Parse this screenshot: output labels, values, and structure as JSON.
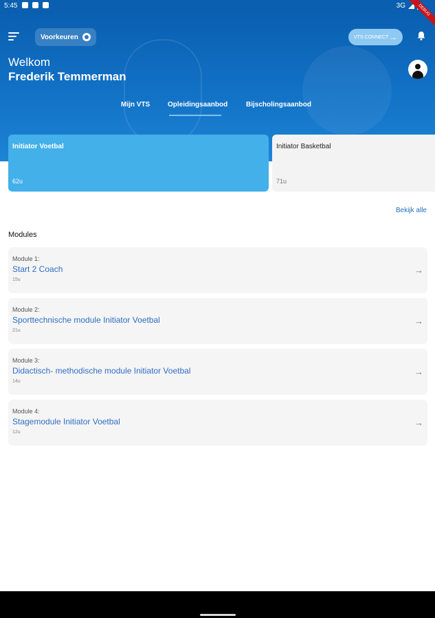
{
  "status_bar": {
    "time": "5:45",
    "network": "3G",
    "icons": [
      "notification-icon",
      "screenshot-icon",
      "download-icon"
    ]
  },
  "header": {
    "preferences_label": "Voorkeuren",
    "connect_label": "VTS CONNECT",
    "welcome": "Welkom",
    "user_name": "Frederik Temmerman"
  },
  "tabs": [
    {
      "label": "Mijn VTS",
      "active": false
    },
    {
      "label": "Opleidingsaanbod",
      "active": true
    },
    {
      "label": "Bijscholingsaanbod",
      "active": false
    }
  ],
  "courses": [
    {
      "title": "Initiator Voetbal",
      "hours": "62u",
      "selected": true
    },
    {
      "title": "Initiator Basketbal",
      "hours": "71u",
      "selected": false
    }
  ],
  "view_all_label": "Bekijk alle",
  "section_title": "Modules",
  "modules": [
    {
      "number": "Module 1:",
      "name": "Start 2 Coach",
      "hours": "15u"
    },
    {
      "number": "Module 2:",
      "name": "Sporttechnische module Initiator Voetbal",
      "hours": "21u"
    },
    {
      "number": "Module 3:",
      "name": "Didactisch- methodische module Initiator Voetbal",
      "hours": "14u"
    },
    {
      "number": "Module 4:",
      "name": "Stagemodule Initiator Voetbal",
      "hours": "12u"
    }
  ],
  "debug_label": "DEBUG",
  "colors": {
    "header_blue": "#0a5fb0",
    "active_card": "#43b0ea",
    "link_blue": "#1f6fb9",
    "module_name": "#2f6ec4"
  }
}
